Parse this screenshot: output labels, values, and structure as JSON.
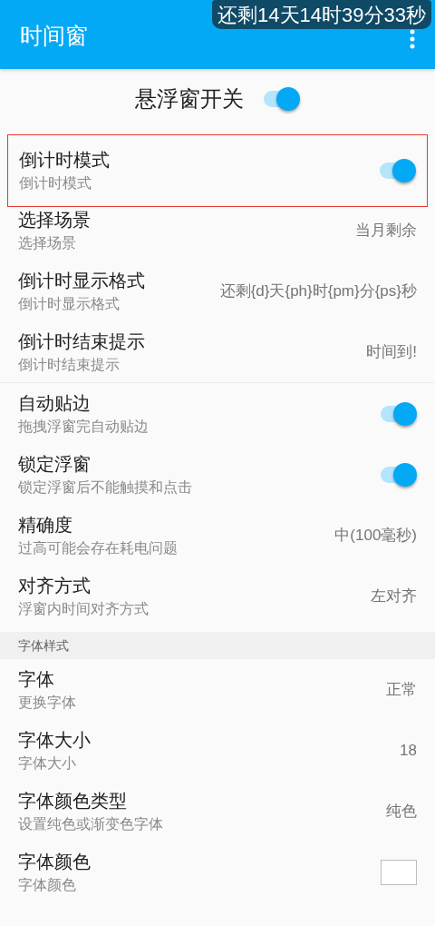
{
  "app_bar": {
    "title": "时间窗"
  },
  "overlay": {
    "text": "还剩14天14时39分33秒"
  },
  "master_switch": {
    "label": "悬浮窗开关",
    "on": true
  },
  "groups": [
    {
      "items": [
        {
          "kind": "switch",
          "title": "倒计时模式",
          "subtitle": "倒计时模式",
          "on": true,
          "highlighted": true
        },
        {
          "kind": "value",
          "title": "选择场景",
          "subtitle": "选择场景",
          "value": "当月剩余"
        },
        {
          "kind": "value",
          "title": "倒计时显示格式",
          "subtitle": "倒计时显示格式",
          "value": "还剩{d}天{ph}时{pm}分{ps}秒"
        },
        {
          "kind": "value",
          "title": "倒计时结束提示",
          "subtitle": "倒计时结束提示",
          "value": "时间到!"
        }
      ]
    },
    {
      "items": [
        {
          "kind": "switch",
          "title": "自动贴边",
          "subtitle": "拖拽浮窗完自动贴边",
          "on": true
        },
        {
          "kind": "switch",
          "title": "锁定浮窗",
          "subtitle": "锁定浮窗后不能触摸和点击",
          "on": true
        },
        {
          "kind": "value",
          "title": "精确度",
          "subtitle": "过高可能会存在耗电问题",
          "value": "中(100毫秒)"
        },
        {
          "kind": "value",
          "title": "对齐方式",
          "subtitle": "浮窗内时间对齐方式",
          "value": "左对齐"
        }
      ]
    },
    {
      "header": "字体样式",
      "items": [
        {
          "kind": "value",
          "title": "字体",
          "subtitle": "更换字体",
          "value": "正常"
        },
        {
          "kind": "value",
          "title": "字体大小",
          "subtitle": "字体大小",
          "value": "18"
        },
        {
          "kind": "value",
          "title": "字体颜色类型",
          "subtitle": "设置纯色或渐变色字体",
          "value": "纯色"
        },
        {
          "kind": "color",
          "title": "字体颜色",
          "subtitle": "字体颜色",
          "color": "#ffffff"
        }
      ]
    }
  ]
}
